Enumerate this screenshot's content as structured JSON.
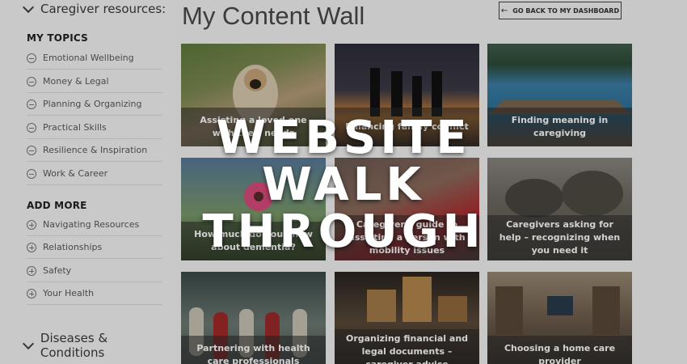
{
  "sidebar": {
    "caregiver_heading": "Caregiver resources:",
    "my_topics_title": "MY TOPICS",
    "my_topics": [
      "Emotional Wellbeing",
      "Money & Legal",
      "Planning & Organizing",
      "Practical Skills",
      "Resilience & Inspiration",
      "Work & Career"
    ],
    "add_more_title": "ADD MORE",
    "add_more": [
      "Navigating Resources",
      "Relationships",
      "Safety",
      "Your Health"
    ],
    "diseases_heading": "Diseases & Conditions"
  },
  "main": {
    "title": "My Content Wall",
    "back_button": "GO BACK TO MY DASHBOARD",
    "cards": [
      "Assisting a loved one with their needs",
      "Balancing family conflict",
      "Finding meaning in caregiving",
      "How much do you know about dementia?",
      "Caregiver's guide to assisting a person with mobility issues",
      "Caregivers asking for help – recognizing when you need it",
      "Partnering with health care professionals",
      "Organizing financial and legal documents – caregiver advice",
      "Choosing a home care provider"
    ]
  },
  "overlay": {
    "line1": "WEBSITE",
    "line2": "WALK",
    "line3": "THROUGH"
  }
}
